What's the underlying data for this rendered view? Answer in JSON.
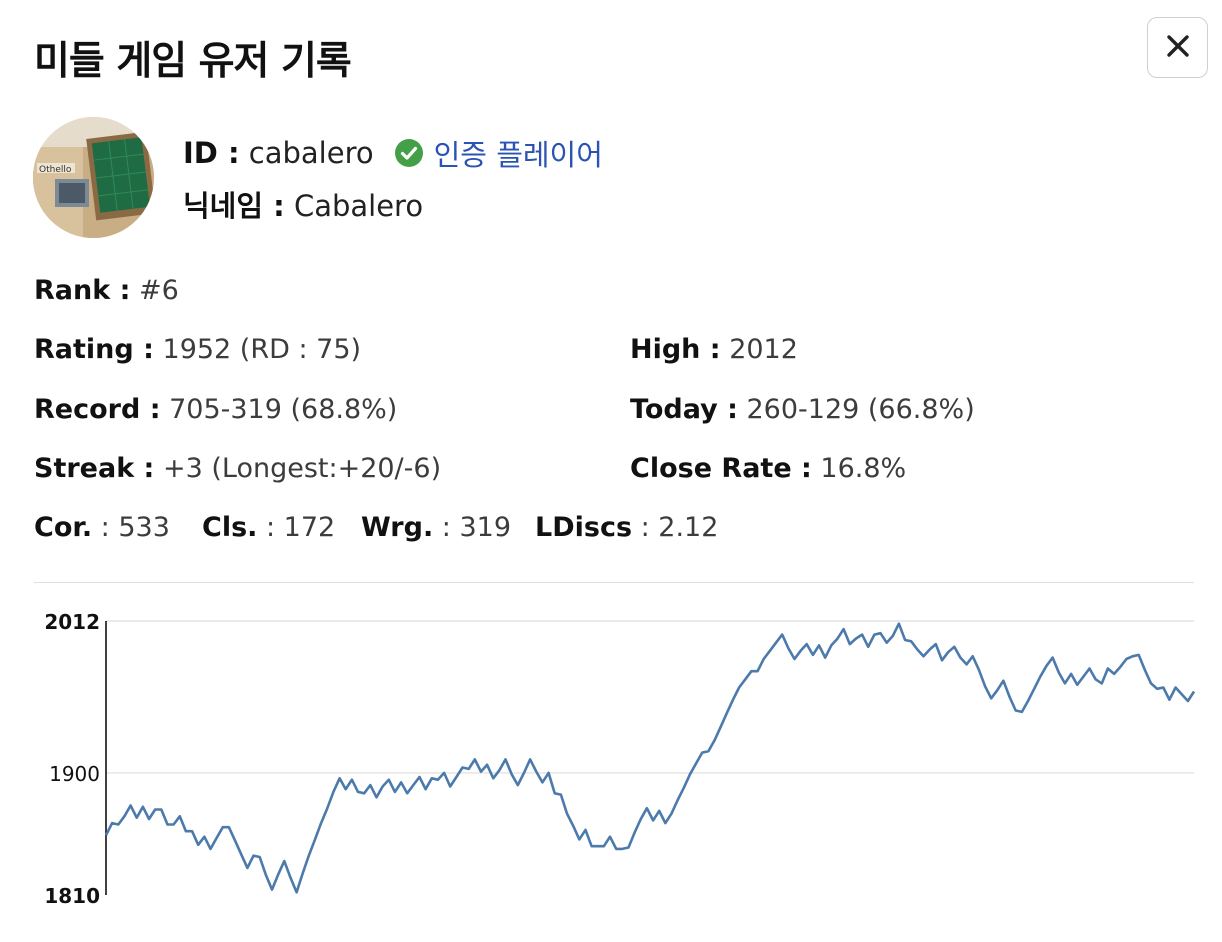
{
  "modal": {
    "title": "미들 게임 유저 기록",
    "close_label": "×"
  },
  "profile": {
    "id_label": "ID :",
    "id_value": "cabalero",
    "verified_label": "인증 플레이어",
    "nickname_label": "닉네임 :",
    "nickname_value": "Cabalero",
    "avatar_icon": "othello-board-avatar"
  },
  "stats": {
    "rank_label": "Rank :",
    "rank_value": "#6",
    "rating_label": "Rating :",
    "rating_value": "1952 (RD : 75)",
    "high_label": "High :",
    "high_value": "2012",
    "record_label": "Record :",
    "record_value": "705-319 (68.8%)",
    "today_label": "Today :",
    "today_value": "260-129 (66.8%)",
    "streak_label": "Streak :",
    "streak_value": "+3 (Longest:+20/-6)",
    "close_rate_label": "Close Rate :",
    "close_rate_value": "16.8%",
    "cor_label": "Cor.",
    "cor_value": " : 533",
    "cls_label": "Cls.",
    "cls_value": " : 172",
    "wrg_label": "Wrg.",
    "wrg_value": " : 319",
    "ldiscs_label": "LDiscs",
    "ldiscs_value": " : 2.12"
  },
  "colors": {
    "verified_green": "#43a047",
    "verified_text": "#2b53b4",
    "line": "#4b7aab",
    "grid": "#dddddd"
  },
  "chart_data": {
    "type": "line",
    "ylim": [
      1810,
      2012
    ],
    "yticks": [
      {
        "value": 2012,
        "label": "2012",
        "bold": true
      },
      {
        "value": 1900,
        "label": "1900",
        "bold": false
      },
      {
        "value": 1810,
        "label": "1810",
        "bold": true
      }
    ],
    "gridlines": [
      2012,
      1900
    ],
    "series": [
      {
        "values": [
          1854,
          1863,
          1862,
          1868,
          1876,
          1867,
          1875,
          1866,
          1873,
          1873,
          1862,
          1862,
          1868,
          1857,
          1857,
          1847,
          1853,
          1844,
          1852,
          1860,
          1860,
          1850,
          1840,
          1830,
          1839,
          1838,
          1825,
          1814,
          1825,
          1835,
          1823,
          1812,
          1826,
          1839,
          1851,
          1863,
          1874,
          1886,
          1896,
          1888,
          1895,
          1886,
          1885,
          1891,
          1882,
          1890,
          1895,
          1886,
          1893,
          1885,
          1891,
          1897,
          1888,
          1896,
          1895,
          1900,
          1890,
          1897,
          1904,
          1903,
          1910,
          1901,
          1906,
          1896,
          1902,
          1910,
          1899,
          1891,
          1900,
          1910,
          1901,
          1893,
          1900,
          1885,
          1884,
          1870,
          1861,
          1851,
          1858,
          1846,
          1846,
          1846,
          1853,
          1844,
          1844,
          1845,
          1856,
          1866,
          1874,
          1865,
          1872,
          1863,
          1870,
          1880,
          1889,
          1899,
          1907,
          1915,
          1916,
          1924,
          1934,
          1944,
          1954,
          1963,
          1969,
          1975,
          1975,
          1984,
          1990,
          1996,
          2002,
          1992,
          1984,
          1990,
          1995,
          1987,
          1994,
          1985,
          1994,
          1999,
          2006,
          1995,
          1999,
          2002,
          1993,
          2002,
          2003,
          1996,
          2001,
          2010,
          1998,
          1997,
          1991,
          1986,
          1991,
          1995,
          1983,
          1989,
          1993,
          1985,
          1980,
          1986,
          1976,
          1964,
          1955,
          1961,
          1968,
          1956,
          1946,
          1945,
          1953,
          1962,
          1971,
          1979,
          1985,
          1974,
          1966,
          1973,
          1965,
          1971,
          1977,
          1969,
          1966,
          1977,
          1973,
          1978,
          1984,
          1986,
          1987,
          1976,
          1966,
          1962,
          1963,
          1954,
          1963,
          1958,
          1953,
          1960
        ]
      }
    ]
  }
}
